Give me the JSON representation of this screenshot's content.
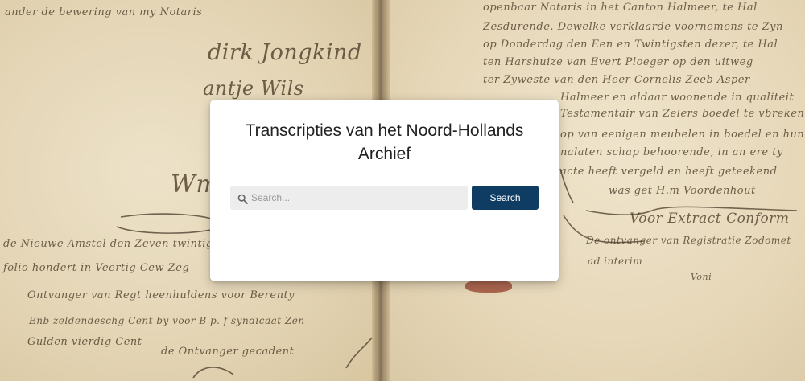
{
  "background": {
    "type": "handwritten-manuscript",
    "left_page_lines": [
      "ander de bewering van my Notaris",
      "dirk Jongkind",
      "antje Wils",
      "Wm",
      "de Nieuwe Amstel den Zeven twintigste",
      "folio hondert in Veertig Cew Zeg",
      "Ontvanger van Regt heenhuldens voor Berenty",
      "Enb zeldendeschg Cent by voor B p. f syndicaat Zen",
      "Gulden vierdig Cent",
      "de Ontvanger gecadent"
    ],
    "right_page_lines": [
      "openbaar Notaris in het Canton Halmeer, te Hal",
      "Zesdurende. Dewelke verklaarde voornemens te Zyn",
      "op Donderdag den Een en Twintigsten dezer, te Hal",
      "ten Harshuize van Evert Ploeger op den uitweg",
      "ter Zyweste van den Heer Cornelis Zeeb Asper",
      "Halmeer en aldaar woonende in qualiteit",
      "Testamentair van Zelers boedel te vbreken",
      "op van eenigen meubelen in boedel en hunnen",
      "nalaten schap behoorende, in an ere ty",
      "acte heeft vergeld en heeft geteekend",
      "was get H.m Voordenhout",
      "Voor Extract Conform",
      "De ontvanger van Registratie Zodomet",
      "ad interim",
      "Voni"
    ]
  },
  "dialog": {
    "title": "Transcripties van het Noord-Hollands Archief",
    "search": {
      "placeholder": "Search...",
      "value": "",
      "icon": "search-icon"
    },
    "search_button_label": "Search"
  },
  "colors": {
    "button_bg": "#0f3c63",
    "button_text": "#ffffff",
    "input_bg": "#ededed",
    "card_bg": "#ffffff",
    "title_text": "#222222"
  }
}
